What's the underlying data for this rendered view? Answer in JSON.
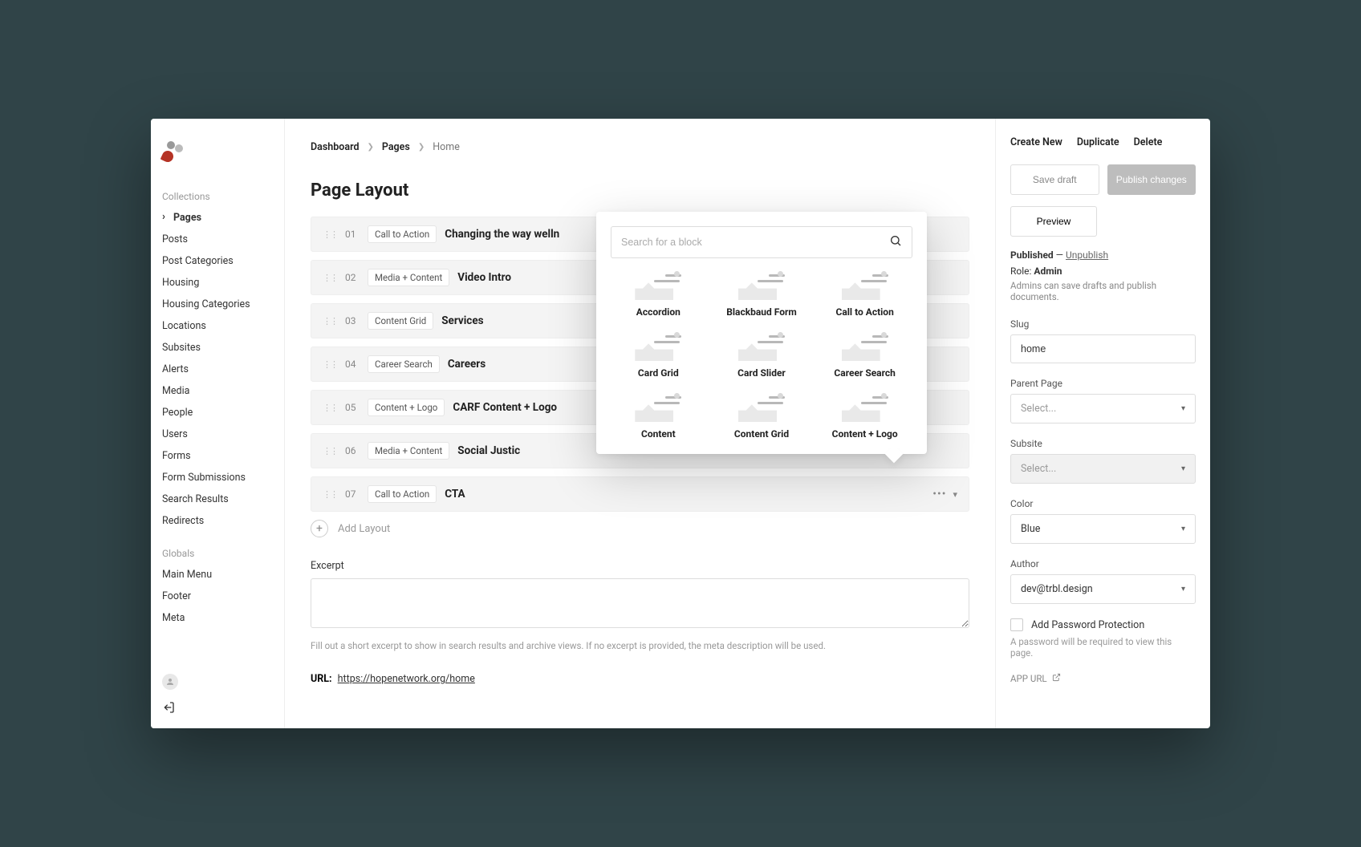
{
  "breadcrumb": [
    "Dashboard",
    "Pages",
    "Home"
  ],
  "sidebar": {
    "section_collections": "Collections",
    "section_globals": "Globals",
    "collections": [
      "Pages",
      "Posts",
      "Post Categories",
      "Housing",
      "Housing Categories",
      "Locations",
      "Subsites",
      "Alerts",
      "Media",
      "People",
      "Users",
      "Forms",
      "Form Submissions",
      "Search Results",
      "Redirects"
    ],
    "globals": [
      "Main Menu",
      "Footer",
      "Meta"
    ],
    "active": "Pages"
  },
  "top_actions": {
    "create": "Create New",
    "duplicate": "Duplicate",
    "delete": "Delete"
  },
  "buttons": {
    "save_draft": "Save draft",
    "publish": "Publish changes",
    "preview": "Preview"
  },
  "status": {
    "label": "Published",
    "dash": " — ",
    "unpublish": "Unpublish"
  },
  "role": {
    "prefix": "Role: ",
    "value": "Admin",
    "help": "Admins can save drafts and publish documents."
  },
  "fields": {
    "slug_label": "Slug",
    "slug_value": "home",
    "parent_label": "Parent Page",
    "parent_placeholder": "Select...",
    "subsite_label": "Subsite",
    "subsite_placeholder": "Select...",
    "color_label": "Color",
    "color_value": "Blue",
    "author_label": "Author",
    "author_value": "dev@trbl.design",
    "pw_label": "Add Password Protection",
    "pw_help": "A password will be required to view this page.",
    "app_url_label": "APP URL"
  },
  "page_title": "Page Layout",
  "layout_blocks": [
    {
      "num": "01",
      "type": "Call to Action",
      "title": "Changing the way welln"
    },
    {
      "num": "02",
      "type": "Media + Content",
      "title": "Video Intro"
    },
    {
      "num": "03",
      "type": "Content Grid",
      "title": "Services"
    },
    {
      "num": "04",
      "type": "Career Search",
      "title": "Careers"
    },
    {
      "num": "05",
      "type": "Content + Logo",
      "title": "CARF Content + Logo"
    },
    {
      "num": "06",
      "type": "Media + Content",
      "title": "Social Justic"
    },
    {
      "num": "07",
      "type": "Call to Action",
      "title": "CTA"
    }
  ],
  "add_layout": "Add Layout",
  "excerpt": {
    "label": "Excerpt",
    "help": "Fill out a short excerpt to show in search results and archive views. If no excerpt is provided, the meta description will be used."
  },
  "url": {
    "label": "URL:",
    "value": "https://hopenetwork.org/home"
  },
  "popover": {
    "search_placeholder": "Search for a block",
    "blocks": [
      "Accordion",
      "Blackbaud Form",
      "Call to Action",
      "Card Grid",
      "Card Slider",
      "Career Search",
      "Content",
      "Content Grid",
      "Content + Logo"
    ]
  }
}
